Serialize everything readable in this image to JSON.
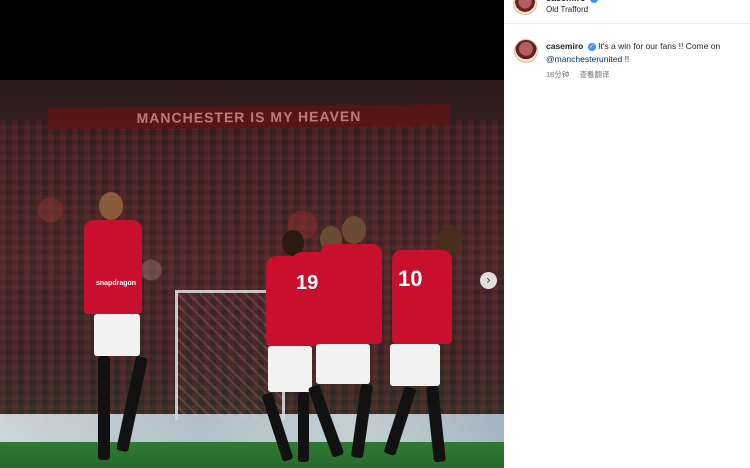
{
  "photo": {
    "banner_text": "MANCHESTER IS MY HEAVEN",
    "sponsor_text": "snapdragon",
    "jersey_numbers": [
      "19",
      "10"
    ]
  },
  "carousel": {
    "next_icon": "chevron-right-icon",
    "next_glyph": "›"
  },
  "post": {
    "username": "casemiro",
    "location": "Old Trafford",
    "verified_icon": "verified-badge-icon",
    "verified_glyph": "✓"
  },
  "comment": {
    "username": "casemiro",
    "text": "It's a win for our fans !! Come on",
    "mention": "@manchesterunited",
    "suffix": " !!",
    "time": "18分钟",
    "translate": "查看翻译"
  },
  "colors": {
    "accent": "#3897f0",
    "link": "#00376b",
    "kit_red": "#c8102e"
  }
}
